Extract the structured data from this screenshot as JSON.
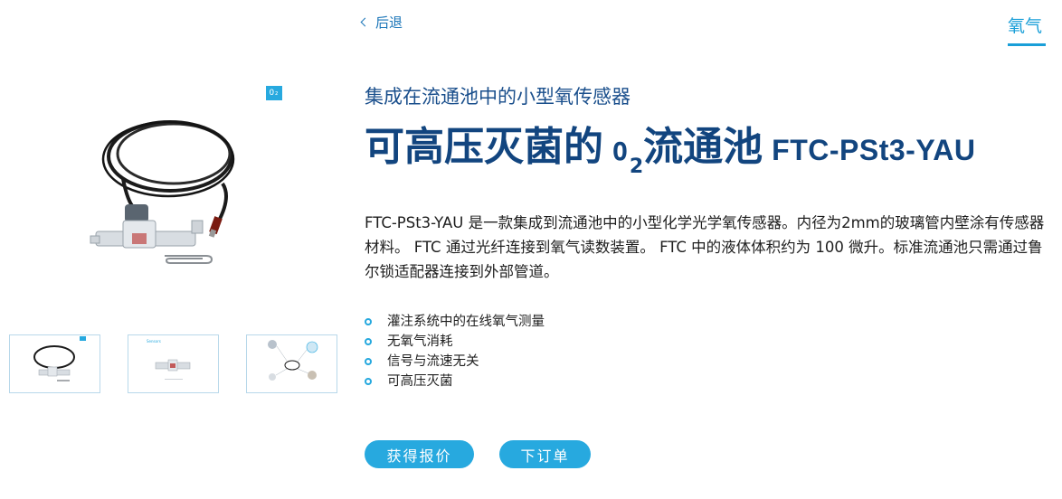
{
  "nav": {
    "back_label": "后退",
    "category_label": "氧气"
  },
  "product": {
    "subtitle": "集成在流通池中的小型氧传感器",
    "title_main": "可高压灭菌的",
    "title_o2": "O",
    "title_o2_sub": "2",
    "title_after": "流通池",
    "title_model": "FTC-PSt3-YAU",
    "description": "FTC-PSt3-YAU 是一款集成到流通池中的小型化学光学氧传感器。内径为2mm的玻璃管内壁涂有传感器材料。 FTC 通过光纤连接到氧气读数装置。 FTC 中的液体体积约为 100 微升。标准流通池只需通过鲁尔锁适配器连接到外部管道。",
    "features": [
      "灌注系统中的在线氧气测量",
      "无氧气消耗",
      "信号与流速无关",
      "可高压灭菌"
    ]
  },
  "gallery": {
    "badge_label": "O₂",
    "thumb2_title": "Sensors"
  },
  "actions": {
    "quote_label": "获得报价",
    "order_label": "下订单"
  },
  "colors": {
    "accent": "#27a9df",
    "title": "#12457f",
    "link": "#1a75b8"
  }
}
